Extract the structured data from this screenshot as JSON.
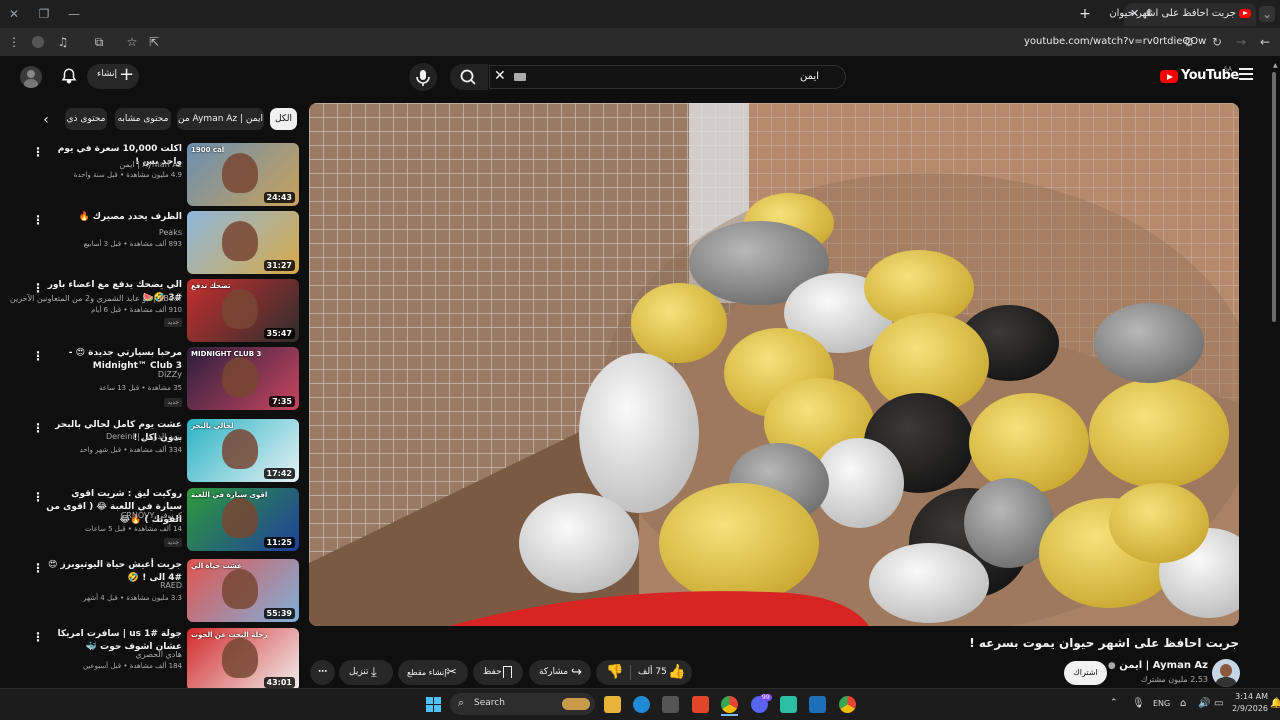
{
  "browser": {
    "tab_title": "جربت احافظ على اشهر حيوان",
    "url": "youtube.com/watch?v=rv0rtdieQOw"
  },
  "header": {
    "create_label": "إنشاء",
    "logo_text": "YouTube",
    "logo_country": "SA",
    "search_value": "ايمن"
  },
  "chips": [
    "الكل",
    "من Ayman Az | ايمن",
    "محتوى مشابه",
    "محتوى ذي"
  ],
  "related": [
    {
      "title": "اكلت 10,000 سعرة في يوم واحد بس !",
      "channel": "Ayman Az | ايمن",
      "meta": "4.9 مليون مشاهدة • قبل سنة واحدة",
      "duration": "24:43",
      "thumb_text": "1900 cal",
      "badge": ""
    },
    {
      "title": "الظرف يحدد مصيرك 🔥",
      "channel": "Peaks",
      "meta": "893 ألف مشاهدة • قبل 3 أسابيع",
      "duration": "31:27",
      "thumb_text": "",
      "badge": ""
    },
    {
      "title": "الي يضحك يدفع مع اعضاء باور #3 🤣🍉",
      "channel": "xBear | ابو عابد الشمري و2 من المتعاونين الآخرين",
      "meta": "910 ألف مشاهدة • قبل 6 أيام",
      "duration": "35:47",
      "thumb_text": "تضحك تدفع",
      "badge": "جديد"
    },
    {
      "title": "مرحبا بسيارتي جديدة 😍 - Midnight™ Club 3",
      "channel": "DiZZy",
      "meta": "35 مشاهدة • قبل 13 ساعة",
      "duration": "7:35",
      "thumb_text": "MIDNIGHT CLUB 3",
      "badge": "جديد"
    },
    {
      "title": "عشت يوم كامل لحالي بالبحر بدون اكل !",
      "channel": "يزيد الدريني | Dereini",
      "meta": "334 ألف مشاهدة • قبل شهر واحد",
      "duration": "17:42",
      "thumb_text": "لحالي بالبحر",
      "badge": ""
    },
    {
      "title": "روكيت ليق : شريت اقوى سيارة في اللعبة 😂 ( اقوى من الفوتك ) 🔥😂",
      "channel": "كرنوفي CRNOVY",
      "meta": "14 ألف مشاهدة • قبل 5 ساعات",
      "duration": "11:25",
      "thumb_text": "اقوى سيارة في اللعبة",
      "badge": "جديد"
    },
    {
      "title": "جربت أعيش حياة اليوتيوبرز 😍 #4 الى ! 🤣",
      "channel": "RAED",
      "meta": "3.3 مليون مشاهدة • قبل 4 أشهر",
      "duration": "55:39",
      "thumb_text": "عشت حياة الي",
      "badge": ""
    },
    {
      "title": "جولة us 1# | سافرت امريكا عشان اشوف حوت 🐳",
      "channel": "هادي الحصري",
      "meta": "184 ألف مشاهدة • قبل أسبوعين",
      "duration": "43:01",
      "thumb_text": "رحلة البحث عن الحوت",
      "badge": ""
    }
  ],
  "video": {
    "title": "جربت احافظ على اشهر حيوان يموت بسرعه !",
    "channel_name": "Ayman Az | ايمن",
    "subscribers": "2.53 مليون مشترك",
    "subscribe_label": "اشتراك",
    "likes": "75 ألف",
    "share_label": "مشاركة",
    "save_label": "حفظ",
    "clip_label": "إنشاء مقطع",
    "download_label": "تنزيل"
  },
  "taskbar": {
    "search_placeholder": "Search",
    "lang": "ENG",
    "time": "3:14 AM",
    "date": "2/9/2026",
    "badge_count": "99"
  }
}
